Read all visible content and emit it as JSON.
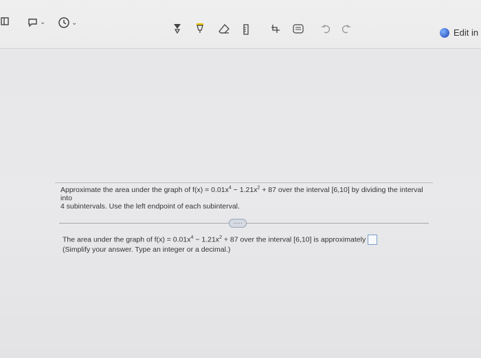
{
  "toolbar": {
    "items": [
      {
        "name": "sidebar-toggle-icon"
      },
      {
        "name": "shape-dropdown-icon"
      },
      {
        "name": "clock-dropdown-icon"
      },
      {
        "name": "lasso-select-icon"
      },
      {
        "name": "highlighter-icon"
      },
      {
        "name": "eraser-icon"
      },
      {
        "name": "ruler-icon"
      },
      {
        "name": "insert-space-icon"
      },
      {
        "name": "ink-to-text-icon"
      },
      {
        "name": "undo-icon"
      },
      {
        "name": "redo-icon"
      }
    ],
    "edit_label": "Edit in F"
  },
  "question": {
    "prefix": "Approximate the area under the graph of f(x) = 0.01x",
    "exp1": "4",
    "mid": " − 1.21x",
    "exp2": "2",
    "suffix": " + 87 over the interval [6,10] by dividing the interval into",
    "line2": "4 subintervals. Use the left endpoint of each subinterval."
  },
  "more_button": "·····",
  "answer": {
    "prefix": "The area under the graph of f(x) = 0.01x",
    "exp1": "4",
    "mid": " − 1.21x",
    "exp2": "2",
    "suffix": " + 87 over the interval [6,10] is approximately",
    "hint": "(Simplify your answer. Type an integer or a decimal.)"
  }
}
